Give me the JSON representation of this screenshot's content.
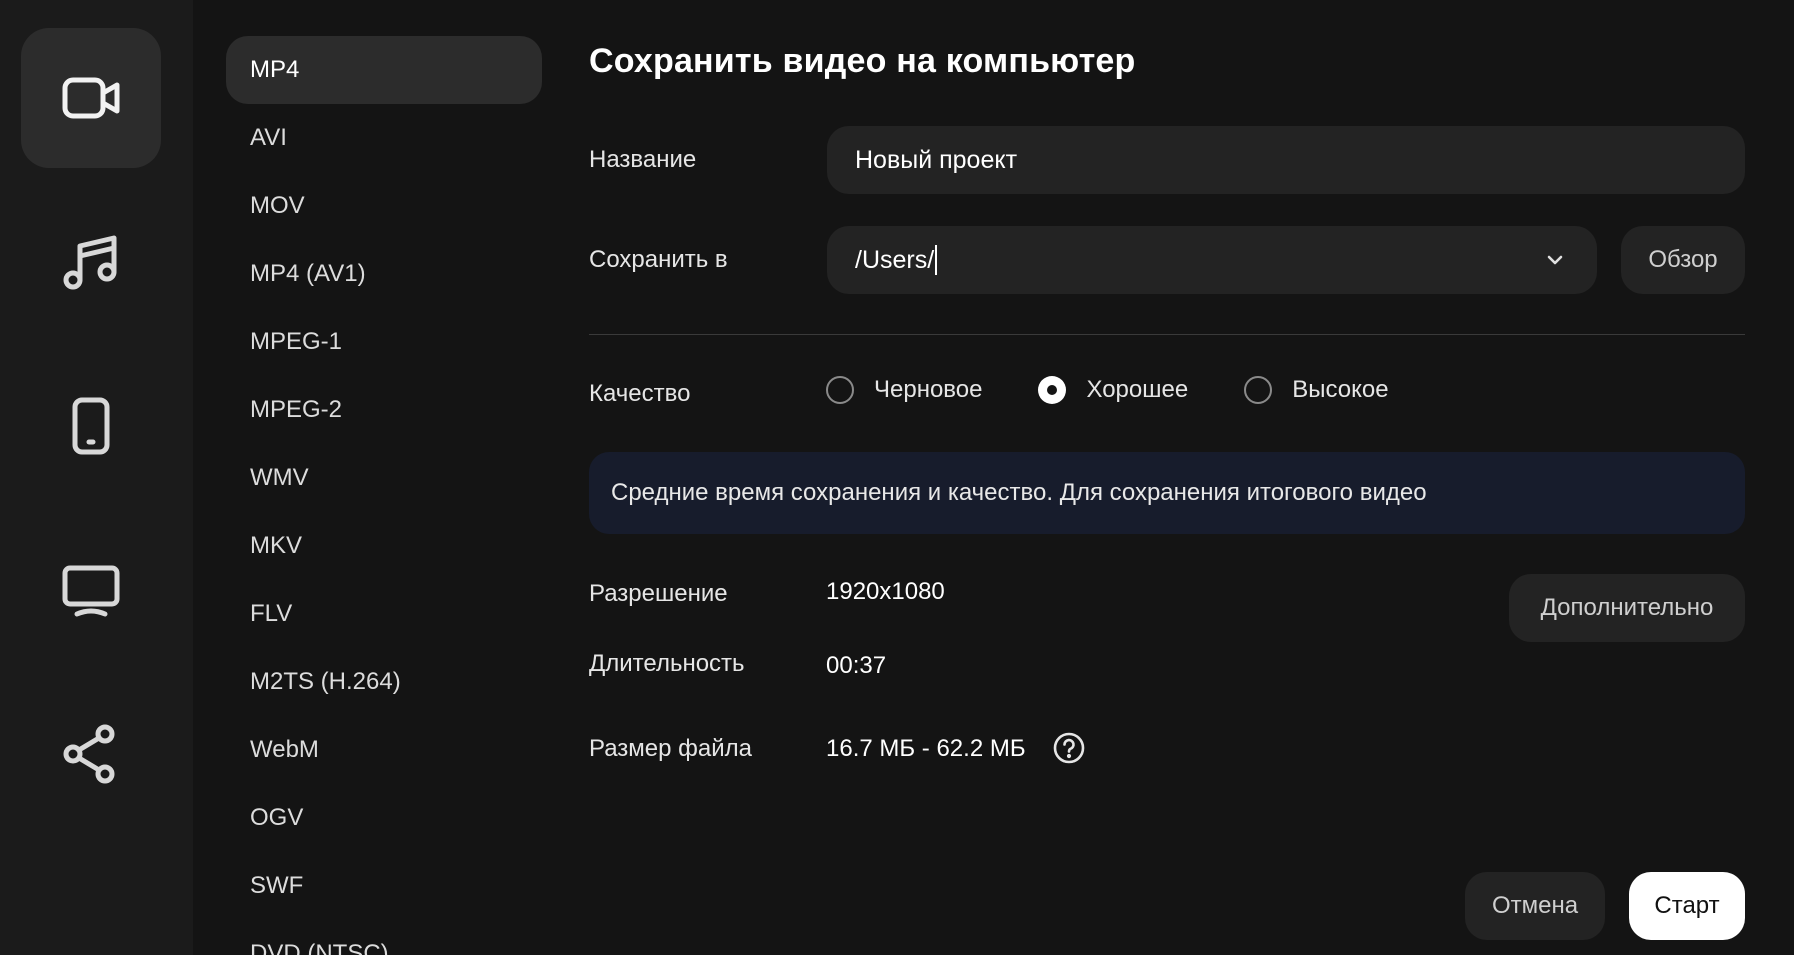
{
  "rail": {
    "items": [
      {
        "icon": "video-camera-icon",
        "active": true
      },
      {
        "icon": "music-note-icon",
        "active": false
      },
      {
        "icon": "smartphone-icon",
        "active": false
      },
      {
        "icon": "monitor-icon",
        "active": false
      },
      {
        "icon": "share-icon",
        "active": false
      }
    ]
  },
  "formats": {
    "selected": "MP4",
    "items": [
      "MP4",
      "AVI",
      "MOV",
      "MP4 (AV1)",
      "MPEG-1",
      "MPEG-2",
      "WMV",
      "MKV",
      "FLV",
      "M2TS (H.264)",
      "WebM",
      "OGV",
      "SWF",
      "DVD (NTSC)"
    ]
  },
  "dialog": {
    "title": "Сохранить видео на компьютер",
    "name_label": "Название",
    "name_value": "Новый проект",
    "save_to_label": "Сохранить в",
    "save_to_value": "/Users/",
    "browse_label": "Обзор",
    "quality_label": "Качество",
    "quality_options": [
      {
        "label": "Черновое",
        "checked": false
      },
      {
        "label": "Хорошее",
        "checked": true
      },
      {
        "label": "Высокое",
        "checked": false
      }
    ],
    "quality_info": "Средние время сохранения и качество. Для сохранения итогового видео",
    "resolution_label": "Разрешение",
    "resolution_value": "1920x1080",
    "advanced_label": "Дополнительно",
    "duration_label": "Длительность",
    "duration_value": "00:37",
    "filesize_label": "Размер файла",
    "filesize_value": "16.7 МБ - 62.2 МБ",
    "cancel_label": "Отмена",
    "start_label": "Старт"
  },
  "colors": {
    "background": "#141414",
    "rail": "#1b1b1b",
    "panel": "#232323",
    "info_box": "#171c2c",
    "primary_button": "#ffffff"
  }
}
